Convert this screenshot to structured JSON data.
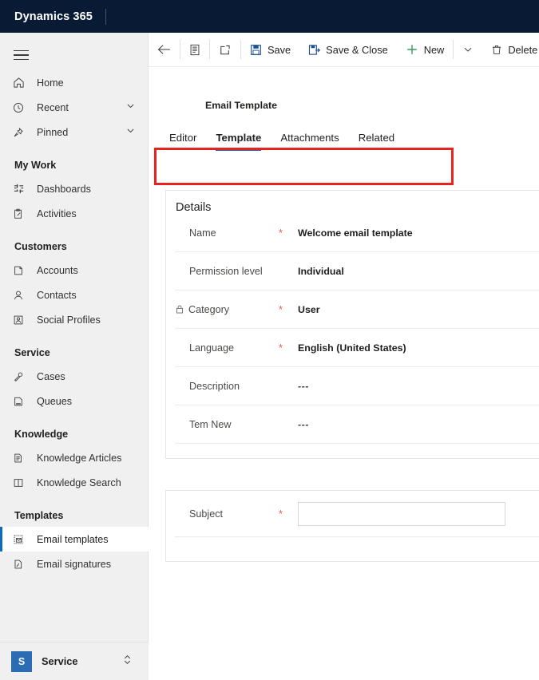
{
  "topbar": {
    "brand": "Dynamics 365"
  },
  "sidebar": {
    "menu_icon": "hamburger-icon",
    "top_items": [
      {
        "label": "Home",
        "icon": "home-icon",
        "chevron": false
      },
      {
        "label": "Recent",
        "icon": "clock-icon",
        "chevron": true
      },
      {
        "label": "Pinned",
        "icon": "pin-icon",
        "chevron": true
      }
    ],
    "groups": [
      {
        "title": "My Work",
        "items": [
          {
            "label": "Dashboards",
            "icon": "dashboard-icon",
            "selected": false
          },
          {
            "label": "Activities",
            "icon": "activities-icon",
            "selected": false
          }
        ]
      },
      {
        "title": "Customers",
        "items": [
          {
            "label": "Accounts",
            "icon": "account-icon",
            "selected": false
          },
          {
            "label": "Contacts",
            "icon": "contact-icon",
            "selected": false
          },
          {
            "label": "Social Profiles",
            "icon": "social-profile-icon",
            "selected": false
          }
        ]
      },
      {
        "title": "Service",
        "items": [
          {
            "label": "Cases",
            "icon": "case-icon",
            "selected": false
          },
          {
            "label": "Queues",
            "icon": "queue-icon",
            "selected": false
          }
        ]
      },
      {
        "title": "Knowledge",
        "items": [
          {
            "label": "Knowledge Articles",
            "icon": "knowledge-article-icon",
            "selected": false
          },
          {
            "label": "Knowledge Search",
            "icon": "knowledge-search-icon",
            "selected": false
          }
        ]
      },
      {
        "title": "Templates",
        "items": [
          {
            "label": "Email templates",
            "icon": "email-template-icon",
            "selected": true
          },
          {
            "label": "Email signatures",
            "icon": "email-signature-icon",
            "selected": false
          }
        ]
      }
    ],
    "app_switcher": {
      "badge": "S",
      "label": "Service",
      "chevron_icon": "updown-chevron-icon"
    }
  },
  "commandbar": {
    "back_icon": "back-arrow-icon",
    "form_icon": "form-selector-icon",
    "popout_icon": "pop-out-icon",
    "save_label": "Save",
    "save_icon": "save-icon",
    "save_close_label": "Save & Close",
    "save_close_icon": "save-and-close-icon",
    "new_label": "New",
    "new_icon": "plus-icon",
    "overflow_icon": "chevron-down-icon",
    "delete_label": "Delete",
    "delete_icon": "trash-icon"
  },
  "record": {
    "entity_title": "Email Template"
  },
  "tabs": [
    {
      "label": "Editor",
      "active": false
    },
    {
      "label": "Template",
      "active": true
    },
    {
      "label": "Attachments",
      "active": false
    },
    {
      "label": "Related",
      "active": false
    }
  ],
  "annotation": {
    "color": "#e8231f",
    "target": "tab-strip"
  },
  "details_section": {
    "title": "Details",
    "fields": [
      {
        "label": "Name",
        "required": true,
        "locked": false,
        "value": "Welcome email template"
      },
      {
        "label": "Permission level",
        "required": false,
        "locked": false,
        "value": "Individual"
      },
      {
        "label": "Category",
        "required": true,
        "locked": true,
        "value": "User"
      },
      {
        "label": "Language",
        "required": true,
        "locked": false,
        "value": "English (United States)"
      },
      {
        "label": "Description",
        "required": false,
        "locked": false,
        "value": "---"
      },
      {
        "label": "Tem New",
        "required": false,
        "locked": false,
        "value": "---"
      }
    ]
  },
  "subject_section": {
    "field": {
      "label": "Subject",
      "required": true,
      "value": ""
    }
  },
  "colors": {
    "navbar": "#091B34",
    "accent": "#2266c4",
    "selected_bar": "#0f6cbd",
    "required_asterisk": "#e05c4a",
    "annotation_red": "#e8231f",
    "app_badge": "#2b6cb3"
  }
}
